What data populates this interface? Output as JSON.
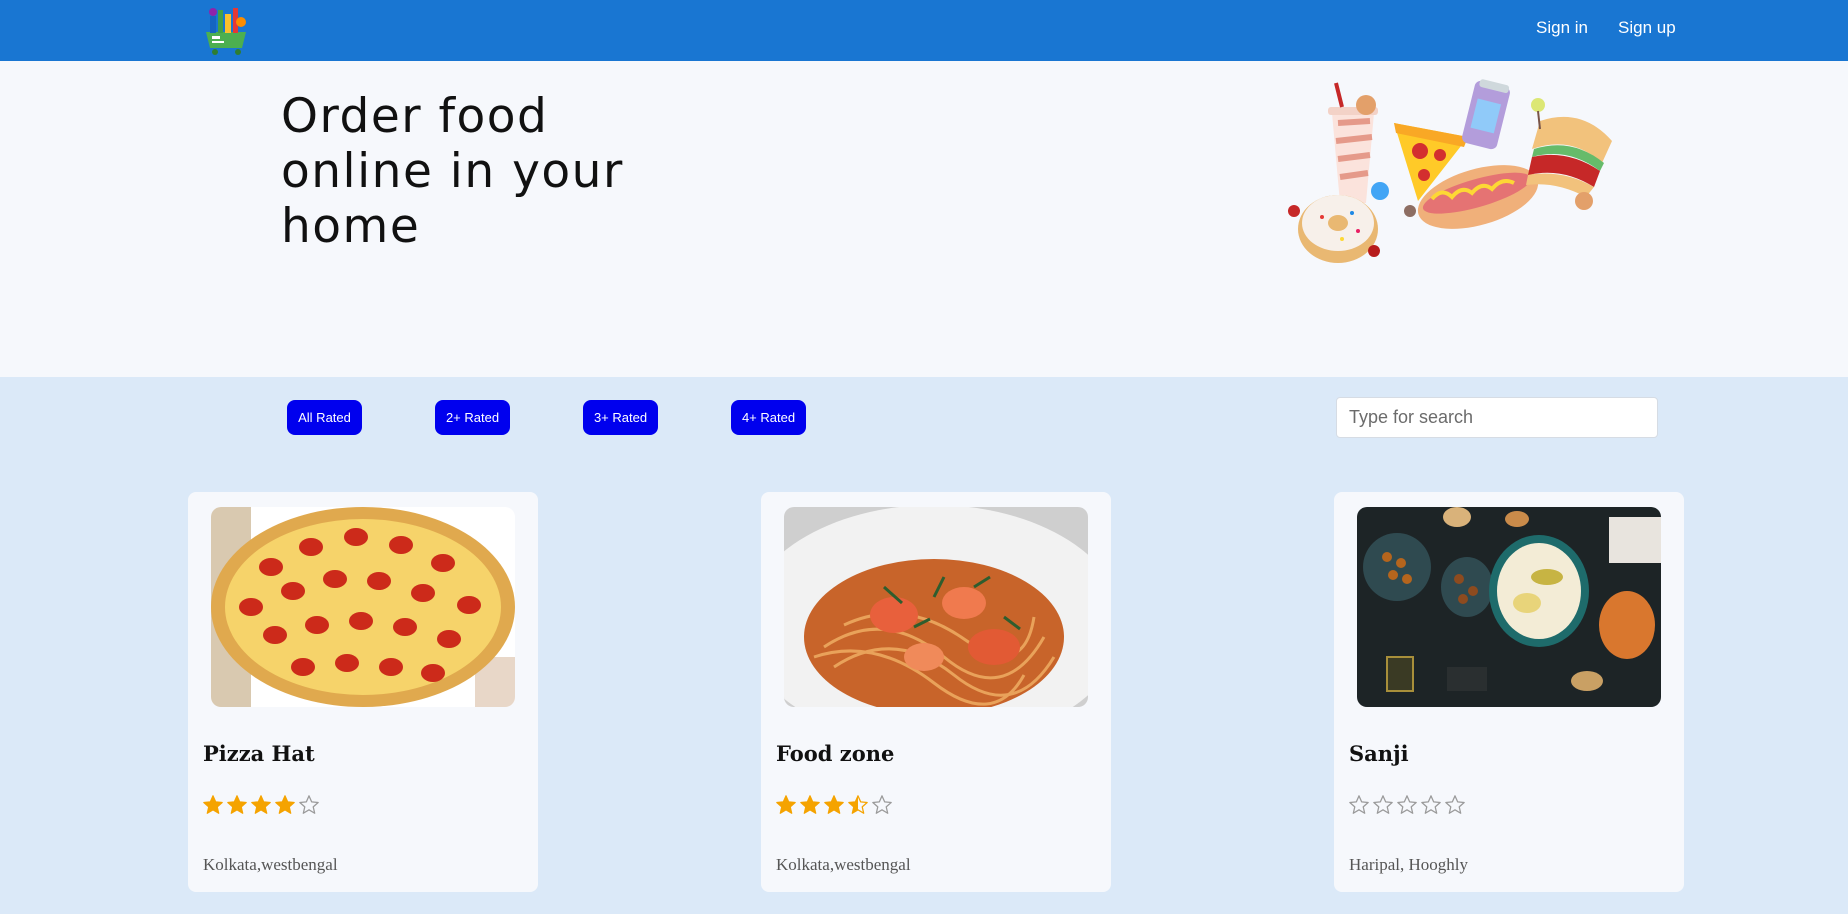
{
  "header": {
    "logo_icon": "grocery-cart-logo",
    "signin_label": "Sign in",
    "signup_label": "Sign up",
    "bg_color": "#1976d2"
  },
  "hero": {
    "title": "Order food online in your home",
    "image_icon": "fast-food-illustration"
  },
  "filters": {
    "buttons": [
      "All Rated",
      "2+ Rated",
      "3+ Rated",
      "4+ Rated"
    ],
    "button_color": "#0000ee",
    "search_placeholder": "Type for search"
  },
  "restaurants": [
    {
      "name": "Pizza Hat",
      "rating": 4,
      "location": "Kolkata,westbengal",
      "image": "pepperoni-pizza"
    },
    {
      "name": "Food zone",
      "rating": 3.5,
      "location": "Kolkata,westbengal",
      "image": "seafood-pasta"
    },
    {
      "name": "Sanji",
      "rating": 0,
      "location": "Haripal, Hooghly",
      "image": "table-spread"
    }
  ],
  "colors": {
    "star": "#f5a300",
    "listing_bg": "#dbe9f8"
  }
}
